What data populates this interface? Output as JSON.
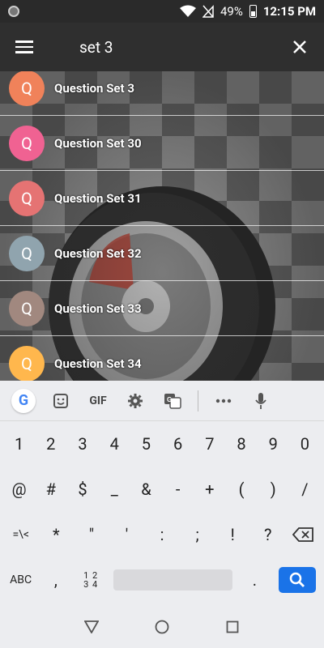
{
  "status_bar": {
    "battery": "49%",
    "time": "12:15 PM"
  },
  "app_bar": {
    "search_value": "set 3"
  },
  "list": {
    "items": [
      {
        "initial": "Q",
        "label": "Question Set 3",
        "color": "#f0825a"
      },
      {
        "initial": "Q",
        "label": "Question Set 30",
        "color": "#f06292"
      },
      {
        "initial": "Q",
        "label": "Question Set 31",
        "color": "#e57373"
      },
      {
        "initial": "Q",
        "label": "Question Set 32",
        "color": "#90a4ae"
      },
      {
        "initial": "Q",
        "label": "Question Set 33",
        "color": "#a1887f"
      },
      {
        "initial": "Q",
        "label": "Question Set 34",
        "color": "#ffb74d"
      }
    ]
  },
  "keyboard": {
    "toolbar": {
      "gif_label": "GIF",
      "google_letter": "G"
    },
    "row1": [
      "1",
      "2",
      "3",
      "4",
      "5",
      "6",
      "7",
      "8",
      "9",
      "0"
    ],
    "row2": [
      "@",
      "#",
      "$",
      "_",
      "&",
      "-",
      "+",
      "(",
      ")",
      "/"
    ],
    "row3": [
      "=\\<",
      "*",
      "\"",
      "'",
      ":",
      ";",
      "!",
      "?"
    ],
    "row4": {
      "abc_label": "ABC",
      "comma": ",",
      "stack_top": "1 2",
      "stack_bottom": "3 4",
      "period": "."
    }
  },
  "colors": {
    "search_key": "#1a73e8",
    "app_bar": "#2f2f2f"
  }
}
